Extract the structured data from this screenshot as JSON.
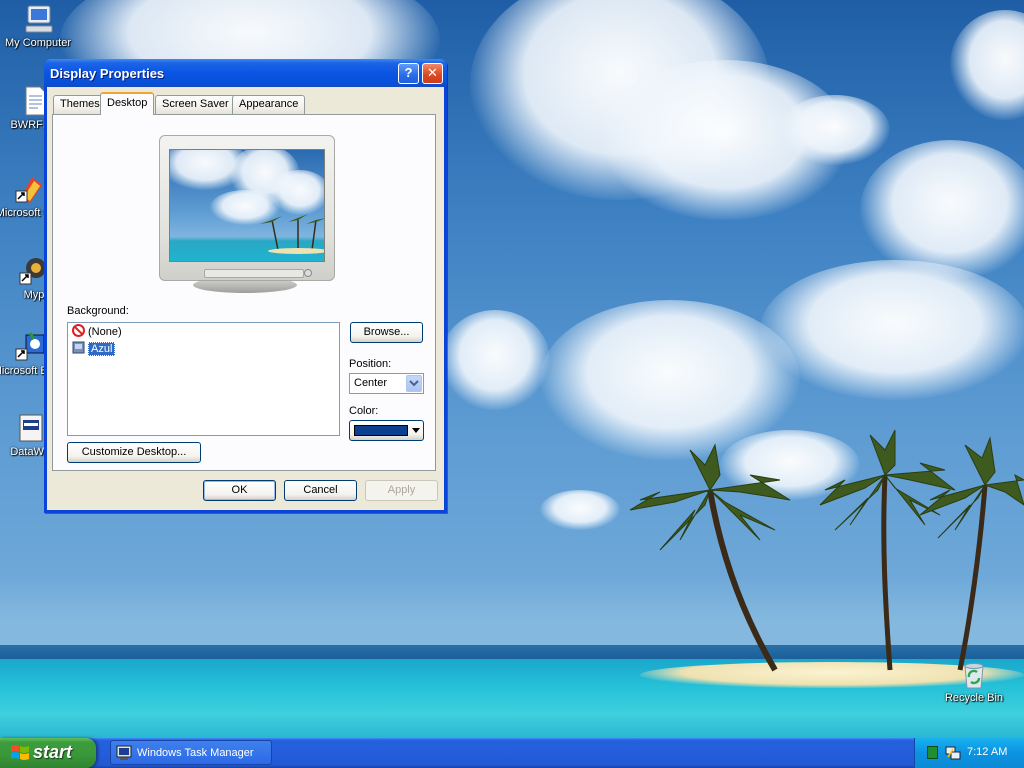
{
  "desktop": {
    "icons": [
      {
        "label": "My Computer",
        "icon": "my-computer-icon"
      },
      {
        "label": "BWRFN-I",
        "icon": "document-icon"
      },
      {
        "label": "Microsoft C++",
        "icon": "shortcut-icon"
      },
      {
        "label": "Myp",
        "icon": "shortcut-icon"
      },
      {
        "label": "Microsoft Basic",
        "icon": "shortcut-icon"
      },
      {
        "label": "DataWa",
        "icon": "application-icon"
      },
      {
        "label": "Recycle Bin",
        "icon": "recycle-bin-icon"
      }
    ]
  },
  "dialog": {
    "title": "Display Properties",
    "help_glyph": "?",
    "close_glyph": "✕",
    "tabs": [
      {
        "label": "Themes"
      },
      {
        "label": "Desktop",
        "active": true
      },
      {
        "label": "Screen Saver"
      },
      {
        "label": "Appearance"
      }
    ],
    "background_label": "Background:",
    "backgrounds": [
      {
        "label": "(None)",
        "icon": "none-icon"
      },
      {
        "label": "Azul",
        "icon": "image-file-icon",
        "selected": true
      }
    ],
    "browse_label": "Browse...",
    "position_label": "Position:",
    "position_value": "Center",
    "color_label": "Color:",
    "color_value": "#0a3f8f",
    "customize_label": "Customize Desktop...",
    "ok_label": "OK",
    "cancel_label": "Cancel",
    "apply_label": "Apply"
  },
  "taskbar": {
    "start_label": "start",
    "task_item_label": "Windows Task Manager",
    "clock": "7:12 AM"
  },
  "colors": {
    "xp_blue": "#0a44d8",
    "start_green": "#3c9c3c",
    "tab_accent": "#f1a534",
    "selection": "#316ac5"
  }
}
